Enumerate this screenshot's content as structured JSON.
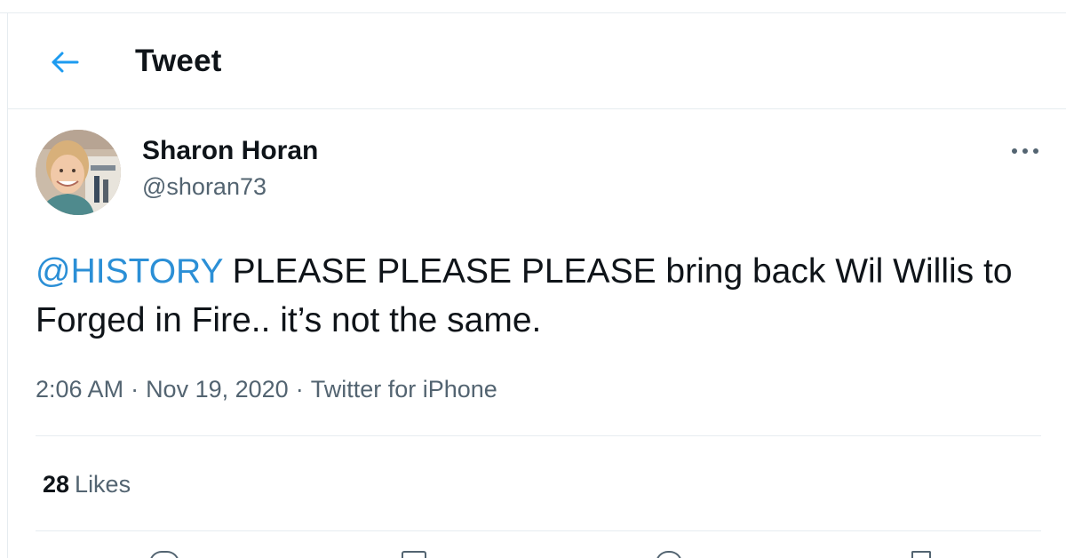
{
  "header": {
    "title": "Tweet",
    "back_icon": "arrow-left-icon",
    "accent_color": "#1d9bf0"
  },
  "tweet": {
    "author": {
      "display_name": "Sharon Horan",
      "handle": "@shoran73",
      "avatar": "profile-photo"
    },
    "text": {
      "mention": "@HISTORY",
      "body": " PLEASE PLEASE PLEASE bring back Wil Willis to Forged in Fire.. it’s not the same."
    },
    "meta": {
      "time": "2:06 AM",
      "separator": "·",
      "date": "Nov 19, 2020",
      "source": "Twitter for iPhone"
    },
    "stats": {
      "likes_count": "28",
      "likes_label": "Likes"
    },
    "more_icon": "more-horizontal-icon"
  }
}
